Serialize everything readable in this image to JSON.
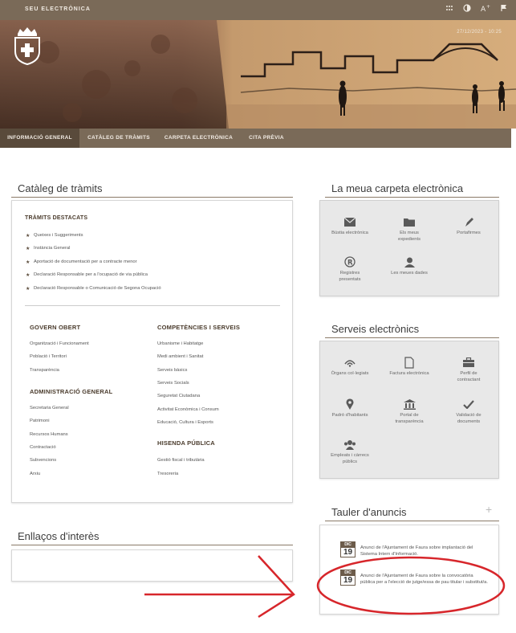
{
  "topbar": {
    "site_name": "SEU ELECTRÒNICA"
  },
  "banner": {
    "date": "27/12/2023 - 10:25"
  },
  "nav": {
    "items": [
      {
        "label": "INFORMACIÓ GENERAL"
      },
      {
        "label": "CATÀLEG DE TRÀMITS"
      },
      {
        "label": "CARPETA ELECTRÒNICA"
      },
      {
        "label": "CITA PRÈVIA"
      }
    ]
  },
  "cataleg": {
    "title": "Catàleg de tràmits",
    "destacats_title": "TRÀMITS DESTACATS",
    "destacats": [
      "Queixes i Suggeriments",
      "Instància General",
      "Aportació de documentació per a contracte menor",
      "Declaració Responsable per a l'ocupació de via pública",
      "Declaració Responsable o Comunicació de Segona Ocupació"
    ],
    "govern_title": "GOVERN OBERT",
    "govern": [
      "Organització i Funcionament",
      "Població i Territori",
      "Transparència"
    ],
    "admin_title": "ADMINISTRACIÓ GENERAL",
    "admin": [
      "Secretaria General",
      "Patrimoni",
      "Recursos Humans",
      "Contractació",
      "Subvencions",
      "Arxiu"
    ],
    "comp_title": "COMPETÈNCIES I SERVEIS",
    "comp": [
      "Urbanisme i Habitatge",
      "Medi ambient i Sanitat",
      "Serveis bàsics",
      "Serveis Socials",
      "Seguretat Ciutadana",
      "Activitat Econòmica i Consum",
      "Educació, Cultura i Esports"
    ],
    "hisenda_title": "HISENDA PÚBLICA",
    "hisenda": [
      "Gestió fiscal i tributària",
      "Tresoreria"
    ]
  },
  "enllacos": {
    "title": "Enllaços d'interès"
  },
  "carpeta": {
    "title": "La meua carpeta electrònica",
    "items": [
      {
        "label": "Bústia electrònica",
        "icon": "envelope-icon"
      },
      {
        "label": "Els meus expedients",
        "icon": "folder-icon"
      },
      {
        "label": "Portafirmes",
        "icon": "pen-icon"
      },
      {
        "label": "Registres presentats",
        "icon": "registered-icon"
      },
      {
        "label": "Les meues dades",
        "icon": "user-icon"
      }
    ]
  },
  "serveis": {
    "title": "Serveis electrònics",
    "items": [
      {
        "label": "Òrgans col·legiats",
        "icon": "broadcast-icon"
      },
      {
        "label": "Factura electrònica",
        "icon": "document-icon"
      },
      {
        "label": "Perfil de contractant",
        "icon": "briefcase-icon"
      },
      {
        "label": "Padró d'habitants",
        "icon": "map-pin-icon"
      },
      {
        "label": "Portal de transparència",
        "icon": "bank-icon"
      },
      {
        "label": "Validació de documents",
        "icon": "check-icon"
      },
      {
        "label": "Empleats i càrrecs públics",
        "icon": "people-icon"
      }
    ]
  },
  "tauler": {
    "title": "Tauler d'anuncis",
    "plus": "+",
    "items": [
      {
        "month": "DIC",
        "day": "19",
        "text": "Anunci de l'Ajuntament de Faura sobre implantació del Sistema Intern d'Informació."
      },
      {
        "month": "DIC",
        "day": "19",
        "text": "Anunci de l'Ajuntament de Faura sobre la convocatòria pública per a l'elecció de jutge/essa de pau titular i substitut/a."
      }
    ]
  },
  "colors": {
    "brand": "#7a6a58",
    "nav_active": "#594a3b",
    "annotation": "#d7262b"
  }
}
